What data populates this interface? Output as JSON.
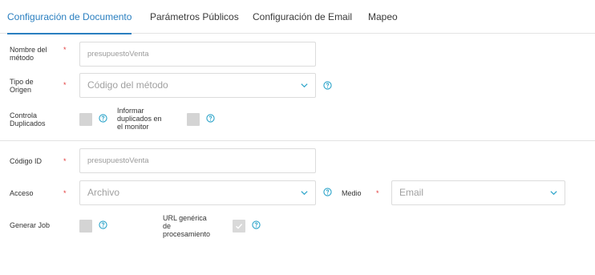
{
  "tabs": [
    {
      "label": "Configuración de Documento",
      "active": true
    },
    {
      "label": "Parámetros Públicos",
      "active": false
    },
    {
      "label": "Configuración de Email",
      "active": false
    },
    {
      "label": "Mapeo",
      "active": false
    }
  ],
  "form": {
    "required_mark": "*",
    "nombre_metodo": {
      "label_line1": "Nombre del",
      "label_line2": "método",
      "value": "presupuestoVenta"
    },
    "tipo_origen": {
      "label_line1": "Tipo de",
      "label_line2": "Origen",
      "placeholder": "Código del método"
    },
    "controla_duplicados": {
      "label_line1": "Controla",
      "label_line2": "Duplicados",
      "checked": false
    },
    "informar_duplicados": {
      "label_line1": "Informar",
      "label_line2": "duplicados en",
      "label_line3": "el monitor",
      "checked": false
    },
    "codigo_id": {
      "label": "Código ID",
      "value": "presupuestoVenta"
    },
    "acceso": {
      "label": "Acceso",
      "value": "Archivo"
    },
    "medio": {
      "label": "Medio",
      "value": "Email"
    },
    "generar_job": {
      "label": "Generar Job",
      "checked": false
    },
    "url_generica": {
      "label_line1": "URL genérica",
      "label_line2": "de",
      "label_line3": "procesamiento",
      "checked": true
    }
  },
  "colors": {
    "accent": "#2a7fc0",
    "required": "#e23a3a",
    "help_icon": "#2aa3c9",
    "checkbox": "#d4d4d4"
  },
  "icons": {
    "help": "question-circle-icon",
    "dropdown": "chevron-down-icon",
    "check": "check-icon"
  }
}
